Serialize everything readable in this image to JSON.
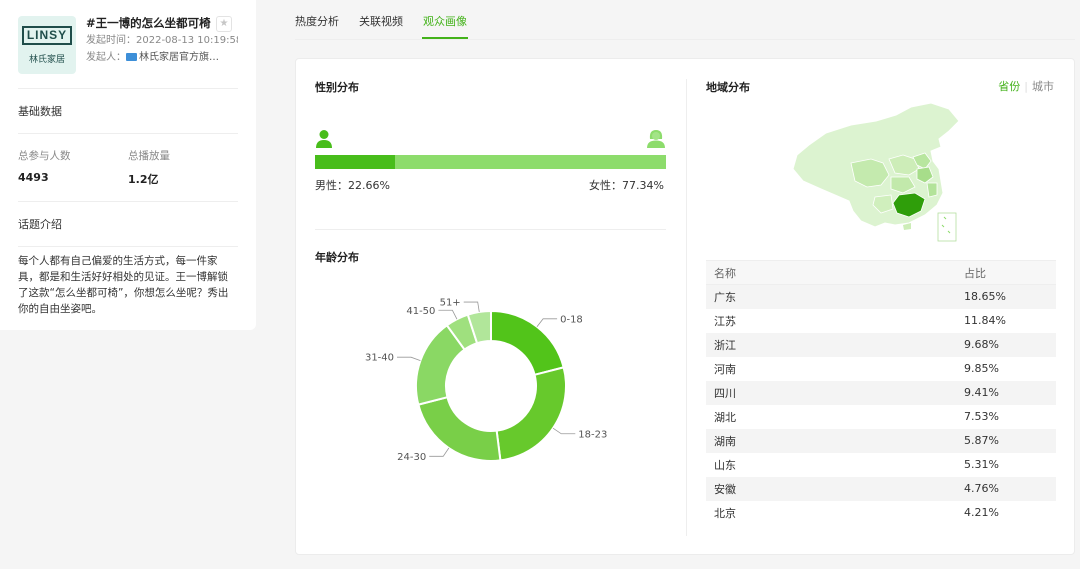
{
  "topic": {
    "logo_text": "LINSY",
    "logo_sub": "林氏家居",
    "title": "#王一博的怎么坐都可椅",
    "time_label": "发起时间：",
    "time_value": "2022-08-13 10:19:58",
    "creator_label": "发起人：",
    "creator_value": "林氏家居官方旗…"
  },
  "basic": {
    "title": "基础数据",
    "participants_label": "总参与人数",
    "participants_value": "4493",
    "plays_label": "总播放量",
    "plays_value": "1.2亿"
  },
  "intro": {
    "title": "话题介绍",
    "text": "每个人都有自己偏爱的生活方式，每一件家具，都是和生活好好相处的见证。王一博解锁了这款“怎么坐都可椅”，你想怎么坐呢？秀出你的自由坐姿吧。"
  },
  "tabs": [
    "热度分析",
    "关联视频",
    "观众画像"
  ],
  "active_tab": 2,
  "gender": {
    "title": "性别分布",
    "male_label": "男性：22.66%",
    "female_label": "女性：77.34%",
    "male_pct": 22.66,
    "colors": {
      "male": "#48bd1b",
      "female": "#8ddc6c"
    }
  },
  "age": {
    "title": "年龄分布"
  },
  "chart_data": {
    "type": "pie",
    "variant": "donut",
    "categories": [
      "0-18",
      "18-23",
      "24-30",
      "31-40",
      "41-50",
      "51+"
    ],
    "values": [
      21,
      27,
      23,
      19,
      5,
      5
    ],
    "colors": [
      "#52c41a",
      "#67c92c",
      "#79cf48",
      "#8ad864",
      "#9fe07e",
      "#b1e69a"
    ]
  },
  "region": {
    "title": "地域分布",
    "toggle_on": "省份",
    "toggle_off": "城市",
    "header_name": "名称",
    "header_pct": "占比",
    "rows": [
      {
        "name": "广东",
        "pct": "18.65%"
      },
      {
        "name": "江苏",
        "pct": "11.84%"
      },
      {
        "name": "浙江",
        "pct": "9.68%"
      },
      {
        "name": "河南",
        "pct": "9.85%"
      },
      {
        "name": "四川",
        "pct": "9.41%"
      },
      {
        "name": "湖北",
        "pct": "7.53%"
      },
      {
        "name": "湖南",
        "pct": "5.87%"
      },
      {
        "name": "山东",
        "pct": "5.31%"
      },
      {
        "name": "安徽",
        "pct": "4.76%"
      },
      {
        "name": "北京",
        "pct": "4.21%"
      }
    ]
  },
  "icons": {
    "star": "star-icon",
    "male": "male-person-icon",
    "female": "female-person-icon",
    "tv": "tv-icon"
  }
}
